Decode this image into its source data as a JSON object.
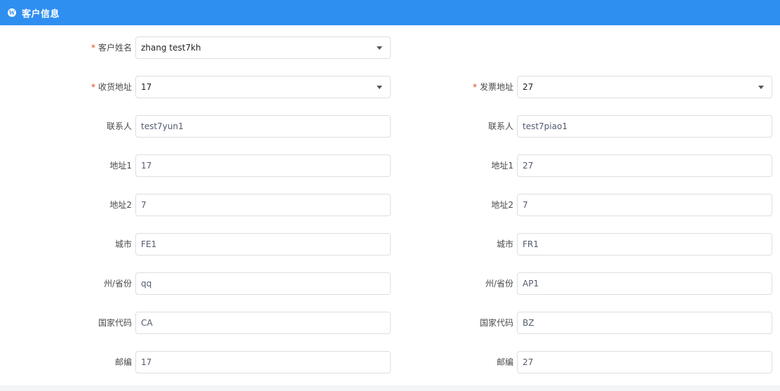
{
  "header": {
    "icon": "wordpress-icon",
    "title": "客户信息"
  },
  "colors": {
    "accent": "#2f8ff0",
    "required": "#ed4014",
    "border": "#dcdee2"
  },
  "customer": {
    "label": "客户姓名",
    "value": "zhang test7kh"
  },
  "shipping": {
    "address_label": "收货地址",
    "address_value": "17",
    "contact_label": "联系人",
    "contact_value": "test7yun1",
    "addr1_label": "地址1",
    "addr1_value": "17",
    "addr2_label": "地址2",
    "addr2_value": "7",
    "city_label": "城市",
    "city_value": "FE1",
    "state_label": "州/省份",
    "state_value": "qq",
    "country_label": "国家代码",
    "country_value": "CA",
    "zip_label": "邮编",
    "zip_value": "17"
  },
  "billing": {
    "address_label": "发票地址",
    "address_value": "27",
    "contact_label": "联系人",
    "contact_value": "test7piao1",
    "addr1_label": "地址1",
    "addr1_value": "27",
    "addr2_label": "地址2",
    "addr2_value": "7",
    "city_label": "城市",
    "city_value": "FR1",
    "state_label": "州/省份",
    "state_value": "AP1",
    "country_label": "国家代码",
    "country_value": "BZ",
    "zip_label": "邮编",
    "zip_value": "27"
  }
}
